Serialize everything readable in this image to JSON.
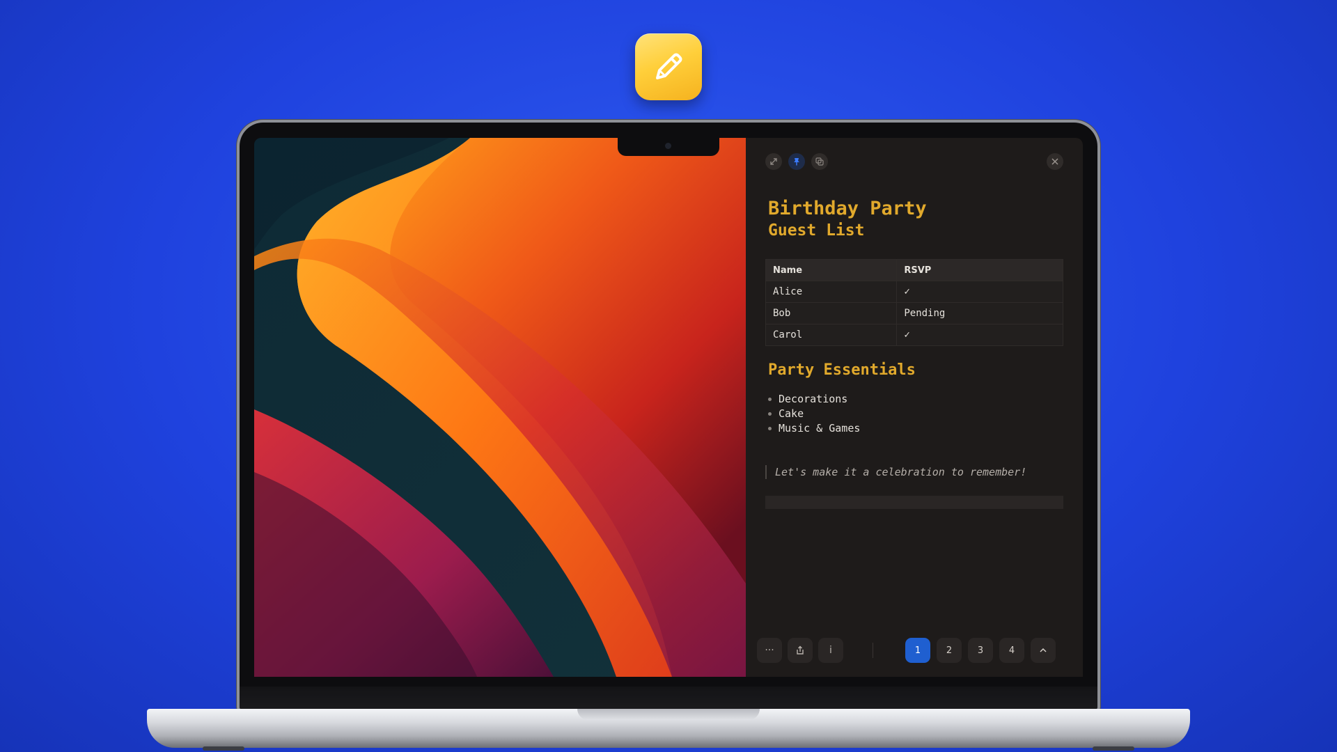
{
  "app_icon": {
    "icon": "pencil-icon",
    "color": "#ffcf3a"
  },
  "panel": {
    "toolbar": {
      "expand_icon": "expand-icon",
      "pin_icon": "pin-icon",
      "copy_icon": "copy-icon",
      "close_icon": "close-icon"
    },
    "title": "Birthday Party",
    "subtitle": "Guest List",
    "table": {
      "headers": [
        "Name",
        "RSVP"
      ],
      "rows": [
        [
          "Alice",
          "✓"
        ],
        [
          "Bob",
          "Pending"
        ],
        [
          "Carol",
          "✓"
        ]
      ]
    },
    "essentials_heading": "Party Essentials",
    "essentials": [
      "Decorations",
      "Cake",
      "Music & Games"
    ],
    "quote": "Let's make it a celebration to remember!",
    "bottom_bar": {
      "more_label": "···",
      "share_icon": "share-icon",
      "info_label": "i",
      "pages": [
        "1",
        "2",
        "3",
        "4"
      ],
      "active_page": "1",
      "collapse_icon": "chevron-up-icon"
    }
  },
  "colors": {
    "accent_heading": "#e1a92c",
    "active_page": "#1f5fd0",
    "background": "#2f5cf2"
  }
}
